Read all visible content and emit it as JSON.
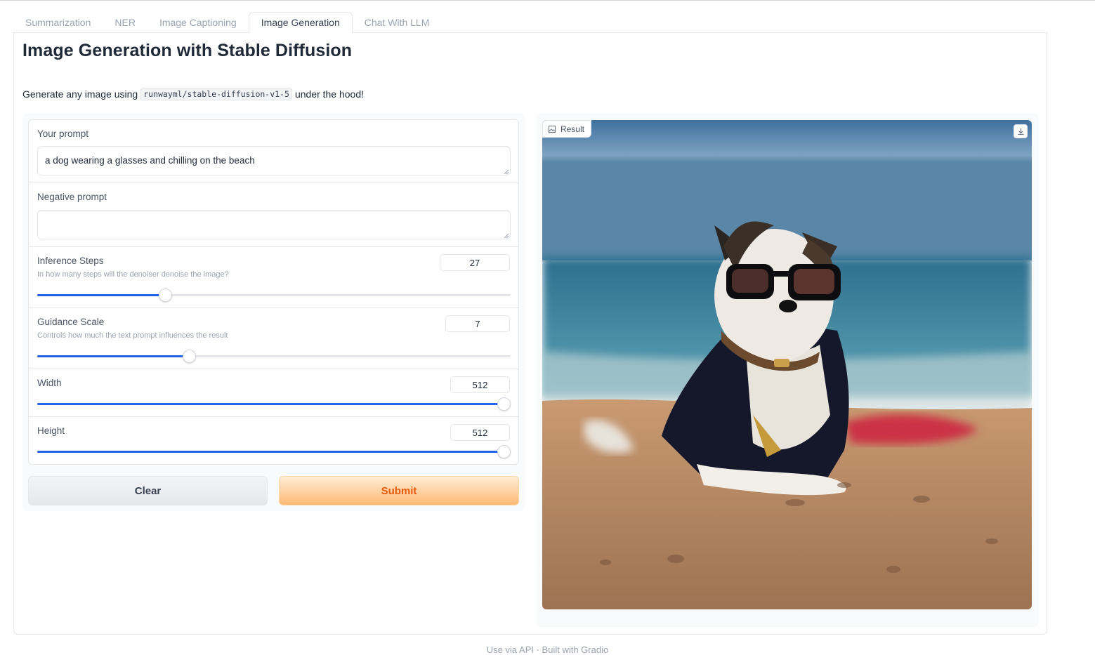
{
  "tabs": [
    "Summarization",
    "NER",
    "Image Captioning",
    "Image Generation",
    "Chat With LLM"
  ],
  "active_tab": "Image Generation",
  "title": "Image Generation with Stable Diffusion",
  "description": {
    "prefix": "Generate any image using",
    "model": "runwayml/stable-diffusion-v1-5",
    "suffix": "under the hood!"
  },
  "prompt": {
    "label": "Your prompt",
    "value": "a dog wearing a glasses and chilling on the beach"
  },
  "negative_prompt": {
    "label": "Negative prompt",
    "value": ""
  },
  "inference_steps": {
    "label": "Inference Steps",
    "info": "In how many steps will the denoiser denoise the image?",
    "value": "27",
    "fraction": 0.27
  },
  "guidance_scale": {
    "label": "Guidance Scale",
    "info": "Controls how much the text prompt influences the result",
    "value": "7",
    "fraction": 0.32
  },
  "width": {
    "label": "Width",
    "value": "512",
    "fraction": 0.985
  },
  "height": {
    "label": "Height",
    "value": "512",
    "fraction": 0.985
  },
  "buttons": {
    "clear": "Clear",
    "submit": "Submit"
  },
  "result": {
    "label": "Result",
    "description": "Generated image of a small dog wearing dark sunglasses and a dark vest, lying on sand at the beach"
  },
  "footer": "Use via API  ·  Built with Gradio",
  "colors": {
    "accent": "#2563eb",
    "submit_text": "#ea580c",
    "submit_bg": "#fdba74"
  }
}
